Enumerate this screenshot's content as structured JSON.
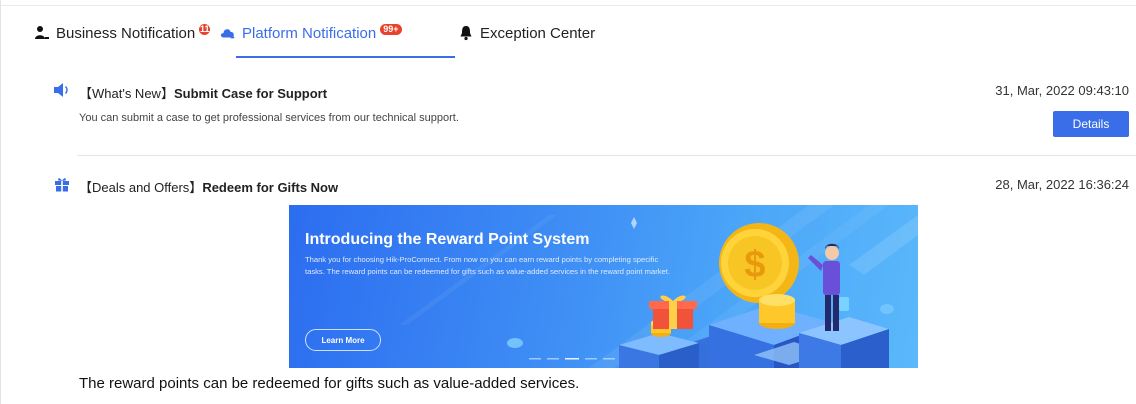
{
  "tabs": [
    {
      "label": "Business Notification",
      "badge": "11",
      "icon": "person-icon",
      "active": false
    },
    {
      "label": "Platform Notification",
      "badge": "99+",
      "icon": "cloud-icon",
      "active": true
    },
    {
      "label": "Exception Center",
      "badge": "",
      "icon": "bell-icon",
      "active": false
    }
  ],
  "notifications": [
    {
      "icon": "speaker-icon",
      "category": "【What's New】",
      "title": "Submit Case for Support",
      "time": "31, Mar, 2022 09:43:10",
      "description": "You can submit a case to get professional services from our technical support.",
      "button": "Details"
    },
    {
      "icon": "gift-icon",
      "category": "【Deals and Offers】",
      "title": "Redeem for Gifts Now",
      "time": "28, Mar, 2022 16:36:24",
      "banner": {
        "headline": "Introducing the Reward Point System",
        "body": "Thank you for choosing Hik-ProConnect. From now on you can earn reward points by completing specific tasks. The reward points can be redeemed for gifts such as value-added services in the reward point market.",
        "button": "Learn More",
        "coin_symbol": "$"
      },
      "summary": "The reward points can be redeemed for gifts such as value-added services."
    }
  ],
  "colors": {
    "accent": "#3a6ee8",
    "badge": "#e8412c"
  }
}
